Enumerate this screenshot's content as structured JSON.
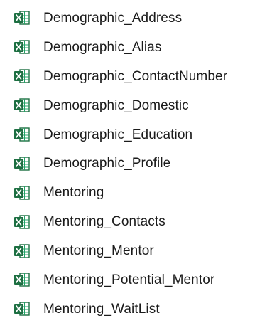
{
  "file_icon": "excel-spreadsheet-icon",
  "icon_colors": {
    "green": "#1D6F42",
    "green_light": "#21A366",
    "sheet_bg": "#ffffff"
  },
  "files": [
    {
      "name": "Demographic_Address"
    },
    {
      "name": "Demographic_Alias"
    },
    {
      "name": "Demographic_ContactNumber"
    },
    {
      "name": "Demographic_Domestic"
    },
    {
      "name": "Demographic_Education"
    },
    {
      "name": "Demographic_Profile"
    },
    {
      "name": "Mentoring"
    },
    {
      "name": "Mentoring_Contacts"
    },
    {
      "name": "Mentoring_Mentor"
    },
    {
      "name": "Mentoring_Potential_Mentor"
    },
    {
      "name": "Mentoring_WaitList"
    }
  ]
}
